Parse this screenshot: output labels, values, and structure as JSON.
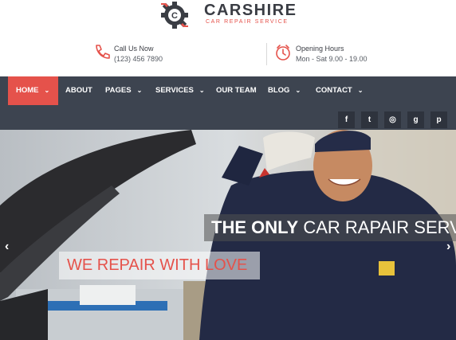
{
  "brand": {
    "name": "CARSHIRE",
    "tagline": "CAR REPAIR SERVICE",
    "logo_letter": "C"
  },
  "contact": {
    "phone": {
      "title": "Call Us Now",
      "value": "(123) 456 7890",
      "icon": "phone-icon"
    },
    "hours": {
      "title": "Opening Hours",
      "value": "Mon - Sat 9.00 - 19.00",
      "icon": "clock-icon"
    }
  },
  "nav": {
    "items": [
      {
        "label": "HOME",
        "active": true,
        "dropdown": true
      },
      {
        "label": "ABOUT",
        "active": false,
        "dropdown": false
      },
      {
        "label": "PAGES",
        "active": false,
        "dropdown": true
      },
      {
        "label": "SERVICES",
        "active": false,
        "dropdown": true
      },
      {
        "label": "OUR TEAM",
        "active": false,
        "dropdown": false
      },
      {
        "label": "BLOG",
        "active": false,
        "dropdown": true
      },
      {
        "label": "CONTACT",
        "active": false,
        "dropdown": true
      }
    ],
    "caret": "⌄"
  },
  "social": [
    {
      "icon": "facebook-icon",
      "glyph": "f"
    },
    {
      "icon": "twitter-icon",
      "glyph": "t"
    },
    {
      "icon": "instagram-icon",
      "glyph": "◎"
    },
    {
      "icon": "google-plus-icon",
      "glyph": "g"
    },
    {
      "icon": "pinterest-icon",
      "glyph": "p"
    }
  ],
  "hero": {
    "caption_strong": "THE ONLY",
    "caption_rest": " CAR RAPAIR SERVICE",
    "subcaption": "WE REPAIR WITH LOVE",
    "prev": "‹",
    "next": "›"
  },
  "colors": {
    "accent": "#e5524b",
    "nav_bg": "#3d4450",
    "text_dark": "#3a3d44"
  }
}
